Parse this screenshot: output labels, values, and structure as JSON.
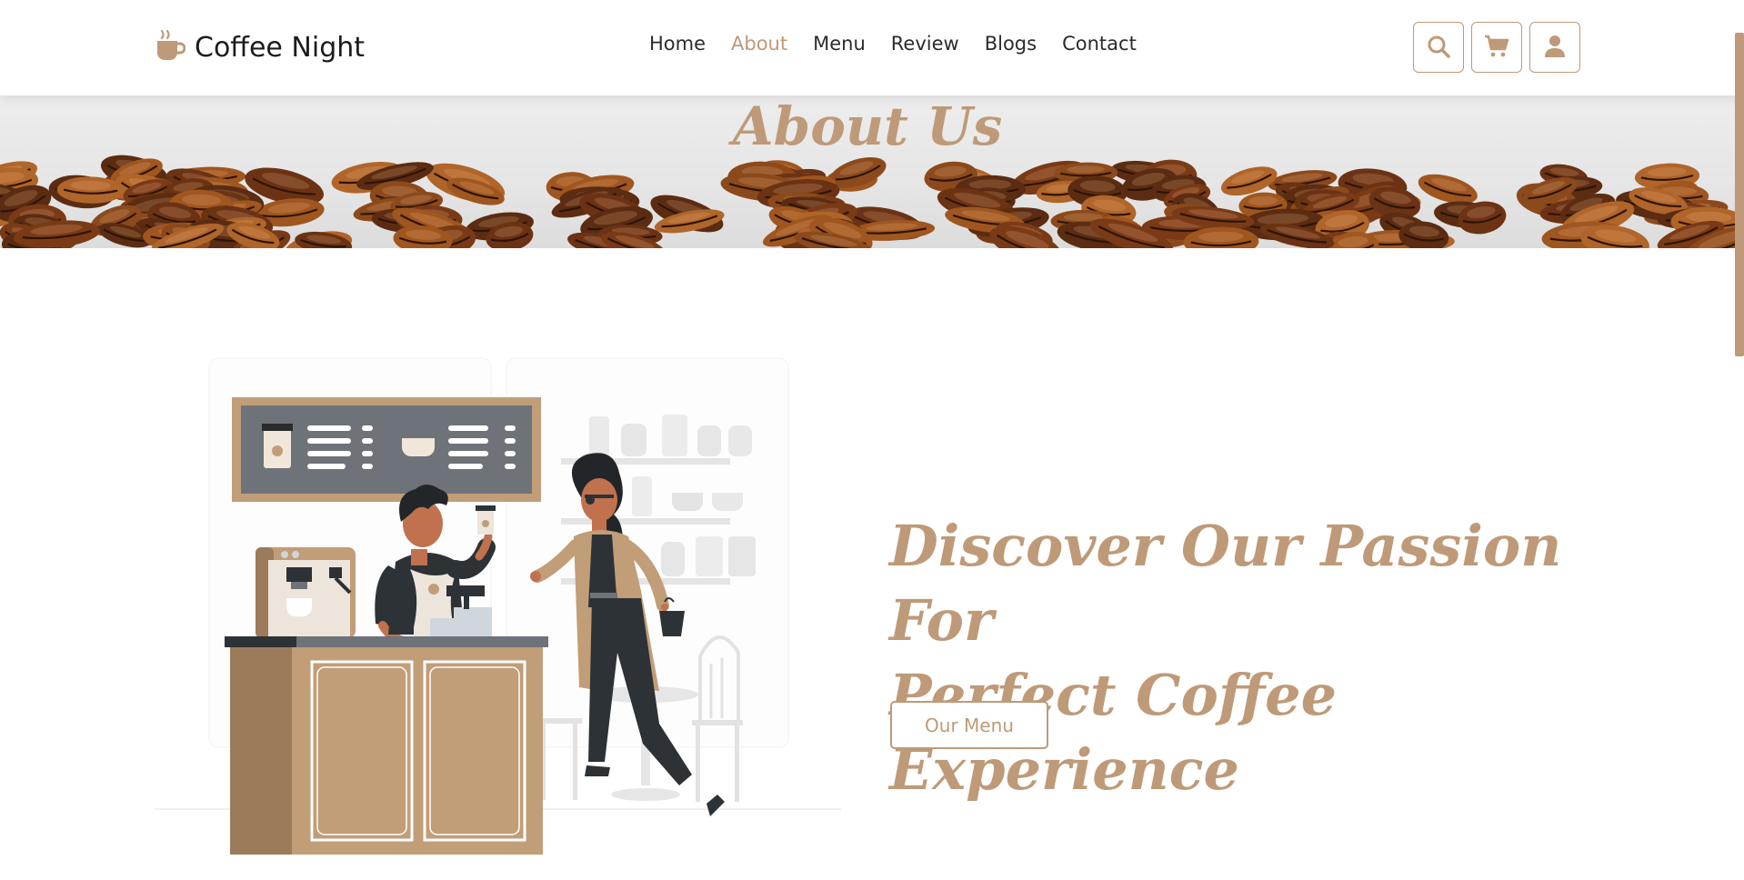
{
  "brand": {
    "name": "Coffee Night",
    "logo_icon": "coffee-cup-icon"
  },
  "nav": {
    "items": [
      {
        "label": "Home",
        "active": false
      },
      {
        "label": "About",
        "active": true
      },
      {
        "label": "Menu",
        "active": false
      },
      {
        "label": "Review",
        "active": false
      },
      {
        "label": "Blogs",
        "active": false
      },
      {
        "label": "Contact",
        "active": false
      }
    ]
  },
  "header_icons": [
    "search-icon",
    "cart-icon",
    "user-icon"
  ],
  "banner": {
    "title": "About Us"
  },
  "hero": {
    "title_line1": "Discover Our Passion For",
    "title_line2": "Perfect Coffee Experience",
    "button_label": "Our Menu"
  },
  "colors": {
    "accent": "#be9a78",
    "text": "#2b2b2b",
    "background": "#ffffff"
  }
}
